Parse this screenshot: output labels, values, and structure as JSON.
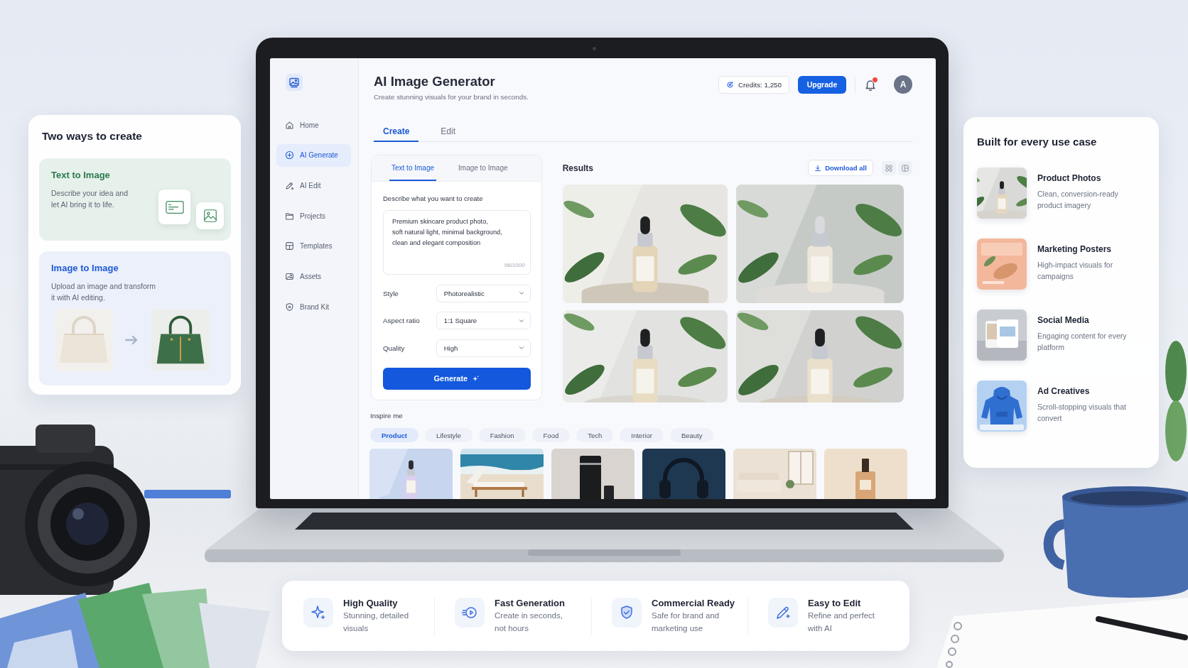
{
  "left_card": {
    "title": "Two ways to create",
    "modes": [
      {
        "kind": "text",
        "title": "Text to Image",
        "description": "Describe your idea and let AI bring it to life."
      },
      {
        "kind": "image",
        "title": "Image to Image",
        "description": "Upload an image and transform it with AI editing."
      }
    ]
  },
  "app": {
    "sidebar": {
      "items": [
        {
          "label": "Home",
          "selected": false
        },
        {
          "label": "AI Generate",
          "selected": true
        },
        {
          "label": "AI Edit",
          "selected": false
        },
        {
          "label": "Projects",
          "selected": false
        },
        {
          "label": "Templates",
          "selected": false
        },
        {
          "label": "Assets",
          "selected": false
        },
        {
          "label": "Brand Kit",
          "selected": false
        }
      ]
    },
    "header": {
      "title": "AI Image Generator",
      "subtitle": "Create stunning visuals for your brand in seconds.",
      "credits": "Credits: 1,250",
      "upgrade": "Upgrade",
      "unread_notifications": true,
      "avatar": "A"
    },
    "tabs": [
      {
        "label": "Create",
        "selected": true
      },
      {
        "label": "Edit",
        "selected": false
      }
    ],
    "form": {
      "tabs": [
        {
          "label": "Text to Image",
          "selected": true
        },
        {
          "label": "Image to Image",
          "selected": false
        }
      ],
      "prompt_label": "Describe what you want to create",
      "prompt": "Premium skincare product photo,\nsoft natural light, minimal background,\nclean and elegant composition",
      "counter": "98/1000",
      "settings": [
        {
          "label": "Style",
          "value": "Photorealistic"
        },
        {
          "label": "Aspect ratio",
          "value": "1:1 Square"
        },
        {
          "label": "Quality",
          "value": "High"
        }
      ],
      "generate": "Generate"
    },
    "results": {
      "title": "Results",
      "download": "Download all"
    },
    "inspire": {
      "title": "Inspire me",
      "categories": [
        {
          "label": "Product",
          "selected": true
        },
        {
          "label": "Lifestyle",
          "selected": false
        },
        {
          "label": "Fashion",
          "selected": false
        },
        {
          "label": "Food",
          "selected": false
        },
        {
          "label": "Tech",
          "selected": false
        },
        {
          "label": "Interior",
          "selected": false
        },
        {
          "label": "Beauty",
          "selected": false
        }
      ]
    }
  },
  "right_card": {
    "title": "Built for every use case",
    "items": [
      {
        "title": "Product Photos",
        "description": "Clean, conversion-ready product imagery"
      },
      {
        "title": "Marketing Posters",
        "description": "High-impact visuals for campaigns"
      },
      {
        "title": "Social Media",
        "description": "Engaging content for every platform"
      },
      {
        "title": "Ad Creatives",
        "description": "Scroll-stopping visuals that convert"
      }
    ]
  },
  "features": [
    {
      "title": "High Quality",
      "description": "Stunning, detailed visuals"
    },
    {
      "title": "Fast Generation",
      "description": "Create in seconds, not hours"
    },
    {
      "title": "Commercial Ready",
      "description": "Safe for brand and marketing use"
    },
    {
      "title": "Easy to Edit",
      "description": "Refine and perfect with AI"
    }
  ]
}
